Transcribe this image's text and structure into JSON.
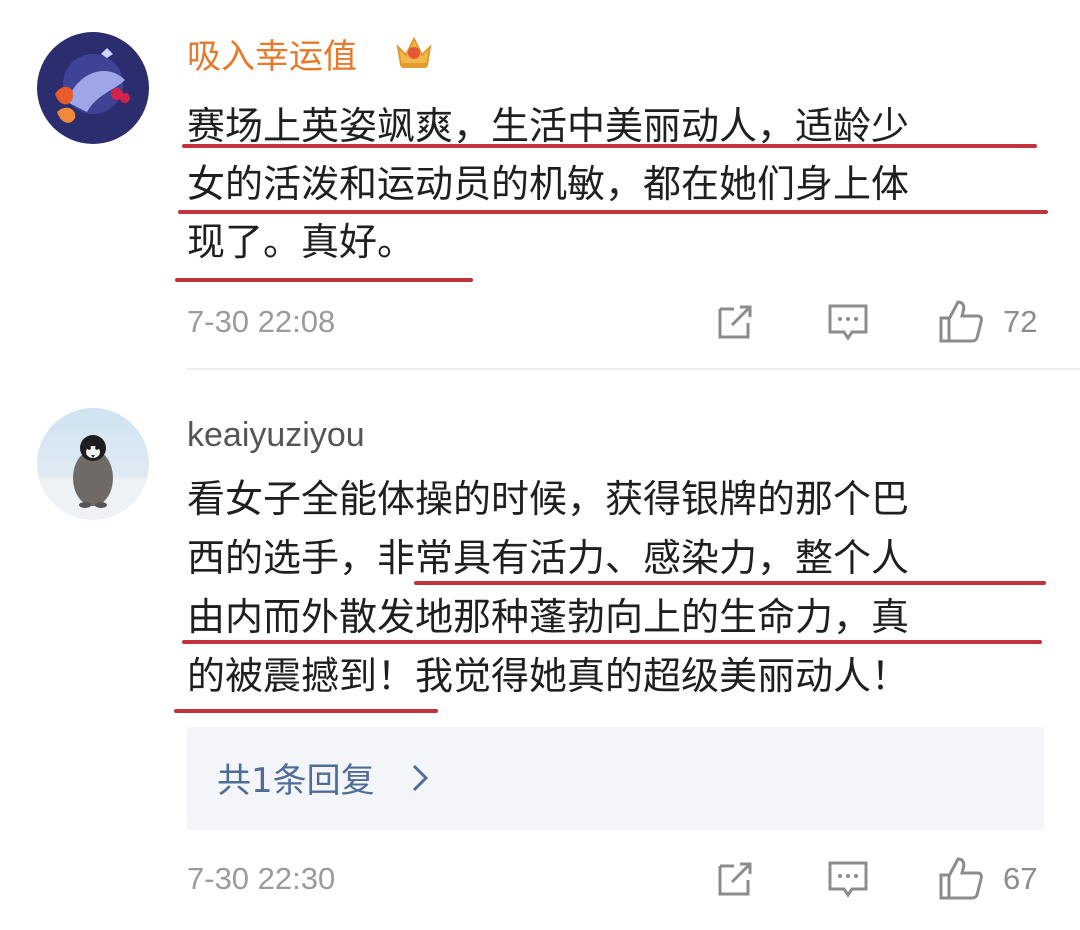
{
  "comments": [
    {
      "username": "吸入幸运值",
      "badge_icon": "crown-icon",
      "lines": [
        "赛场上英姿飒爽，生活中美丽动人，适龄少",
        "女的活泼和运动员的机敏，都在她们身上体",
        "现了。真好。"
      ],
      "time": "7-30 22:08",
      "like_count": "72"
    },
    {
      "username": "keaiyuziyou",
      "lines": [
        "看女子全能体操的时候，获得银牌的那个巴",
        "西的选手，非常具有活力、感染力，整个人",
        "由内而外散发地那种蓬勃向上的生命力，真",
        "的被震撼到！我觉得她真的超级美丽动人！"
      ],
      "reply_label": "共1条回复",
      "time": "7-30 22:30",
      "like_count": "67"
    }
  ],
  "colors": {
    "username_vip": "#e8792b",
    "underline": "#c2323b",
    "reply_link": "#4e6d98"
  }
}
